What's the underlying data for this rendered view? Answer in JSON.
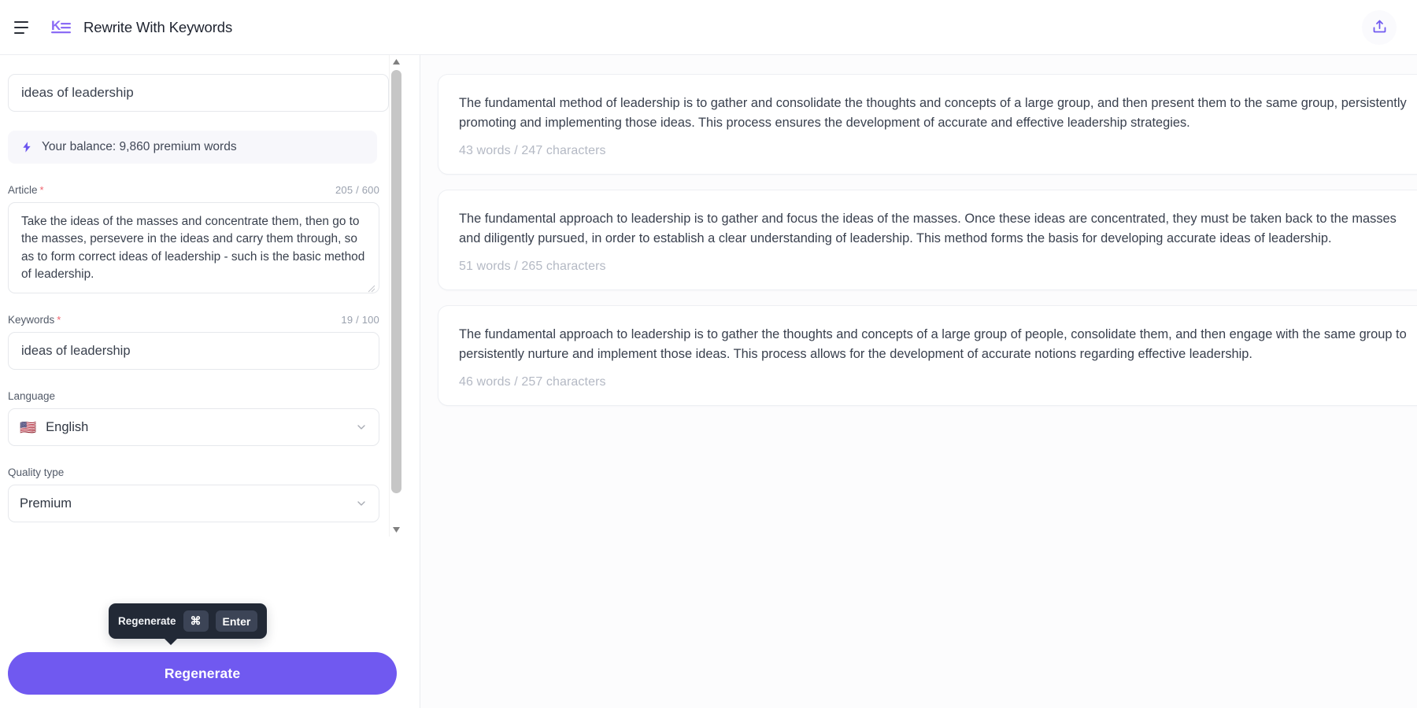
{
  "header": {
    "menu_icon": "hamburger-icon",
    "logo_icon": "keywords-logo-icon",
    "title": "Rewrite With Keywords",
    "share_icon": "share-upload-icon",
    "accent_color": "#7059f0"
  },
  "form": {
    "title_field": {
      "value": "ideas of leadership",
      "placeholder": "Title"
    },
    "balance": {
      "icon": "lightning-bolt-icon",
      "text": "Your balance: 9,860 premium words"
    },
    "article": {
      "label": "Article",
      "required_mark": "*",
      "counter": "205 / 600",
      "value": "Take the ideas of the masses and concentrate them, then go to the masses, persevere in the ideas and carry them through, so as to form correct ideas of leadership - such is the basic method of leadership."
    },
    "keywords": {
      "label": "Keywords",
      "required_mark": "*",
      "counter": "19 / 100",
      "value": "ideas of leadership",
      "placeholder": "Keywords"
    },
    "language": {
      "label": "Language",
      "flag": "🇺🇸",
      "value": "English",
      "chevron_icon": "chevron-down-icon"
    },
    "quality": {
      "label": "Quality type",
      "value": "Premium",
      "chevron_icon": "chevron-down-icon"
    },
    "tooltip": {
      "label": "Regenerate",
      "key_modifier": "⌘",
      "key_action": "Enter"
    },
    "submit": {
      "label": "Regenerate"
    }
  },
  "results": [
    {
      "text": "The fundamental method of leadership is to gather and consolidate the thoughts and concepts of a large group, and then present them to the same group, persistently promoting and implementing those ideas. This process ensures the development of accurate and effective leadership strategies.",
      "meta": "43 words / 247 characters"
    },
    {
      "text": "The fundamental approach to leadership is to gather and focus the ideas of the masses. Once these ideas are concentrated, they must be taken back to the masses and diligently pursued, in order to establish a clear understanding of leadership. This method forms the basis for developing accurate ideas of leadership.",
      "meta": "51 words / 265 characters"
    },
    {
      "text": "The fundamental approach to leadership is to gather the thoughts and concepts of a large group of people, consolidate them, and then engage with the same group to persistently nurture and implement those ideas. This process allows for the development of accurate notions regarding effective leadership.",
      "meta": "46 words / 257 characters"
    }
  ]
}
